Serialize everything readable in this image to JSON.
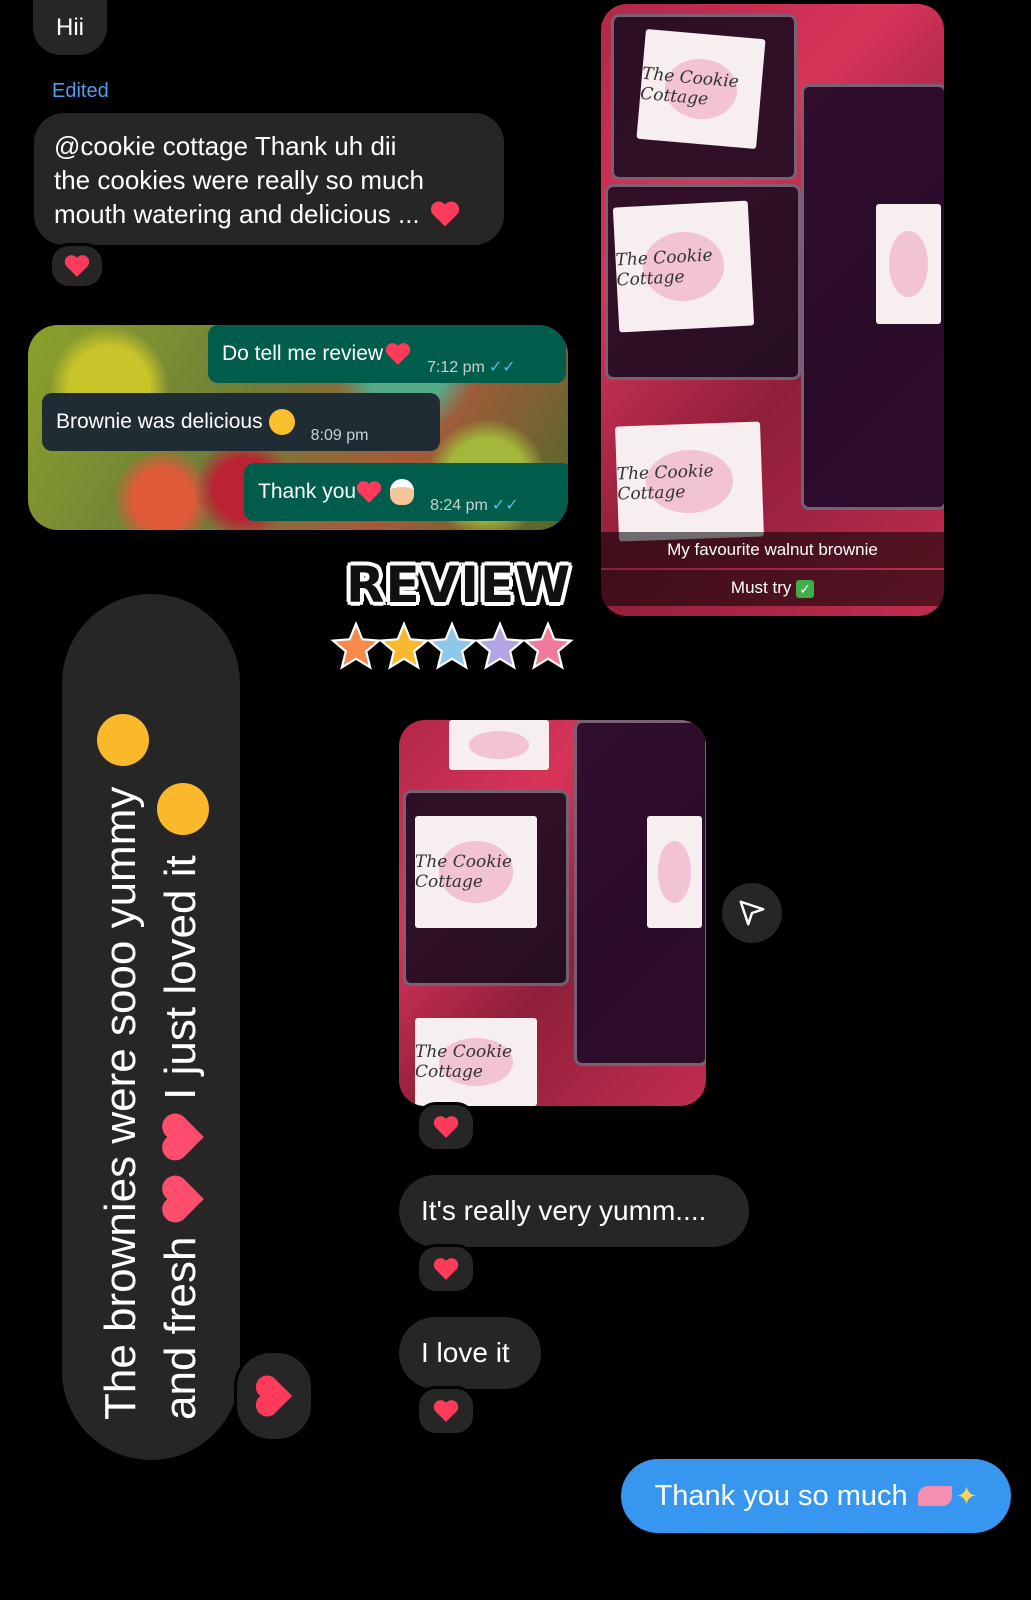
{
  "messages": {
    "hii": "Hii",
    "edited_label": "Edited",
    "review_text_line1": "@cookie cottage  Thank uh dii",
    "review_text_line2": "the cookies were really  so much",
    "review_text_line3": "mouth watering and delicious ...",
    "yummy": "It's really very yumm....",
    "love_it": "I love it",
    "thanks_reply": "Thank you so much"
  },
  "whatsapp": {
    "msg1_text": "Do tell me review",
    "msg1_time": "7:12 pm",
    "msg2_text": "Brownie was delicious",
    "msg2_time": "8:09 pm",
    "msg3_text": "Thank you",
    "msg3_time": "8:24 pm"
  },
  "story": {
    "caption1": "My favourite walnut brownie",
    "caption2": "Must try",
    "label_text": "The Cookie Cottage"
  },
  "rotated_note": {
    "line1": "The brownies were sooo yummy",
    "line2": "and fresh",
    "line2_tail": "I just loved it"
  },
  "sticker": {
    "title": "REVIEW",
    "star_colors": [
      "#f7894a",
      "#f8b92e",
      "#8fc7ea",
      "#b4a4e6",
      "#f27a9b"
    ]
  },
  "colors": {
    "sent_bubble": "#3797f0",
    "received_bubble": "#262626",
    "heart": "#ff3b5c",
    "whatsapp_out": "#005c4b",
    "whatsapp_in": "#1f2c34"
  }
}
